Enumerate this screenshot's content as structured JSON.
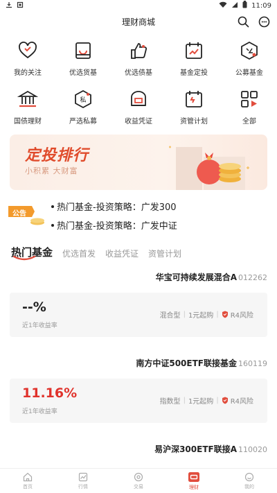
{
  "status": {
    "time": "11:09"
  },
  "header": {
    "title": "理财商城"
  },
  "grid": [
    {
      "label": "我的关注",
      "icon": "heart-icon"
    },
    {
      "label": "优选货基",
      "icon": "card-icon"
    },
    {
      "label": "优选债基",
      "icon": "thumbs-up-icon"
    },
    {
      "label": "基金定投",
      "icon": "calendar-chart-icon"
    },
    {
      "label": "公募基金",
      "icon": "public-fund-icon"
    },
    {
      "label": "国债理财",
      "icon": "bank-icon"
    },
    {
      "label": "严选私募",
      "icon": "private-fund-icon"
    },
    {
      "label": "收益凭证",
      "icon": "certificate-icon"
    },
    {
      "label": "资管计划",
      "icon": "plan-calendar-icon"
    },
    {
      "label": "全部",
      "icon": "all-apps-icon"
    }
  ],
  "banner": {
    "title": "定投排行",
    "subtitle": "小积累 大财富"
  },
  "notice": {
    "badge": "公告",
    "lines": [
      "热门基金-投资策略：广发300",
      "热门基金-投资策略：广发中证"
    ]
  },
  "tabs": [
    "热门基金",
    "优选首发",
    "收益凭证",
    "资管计划"
  ],
  "funds": [
    {
      "name": "华宝可持续发展混合A",
      "code": "012262",
      "rate": "--%",
      "rate_label": "近1年收益率",
      "type": "混合型",
      "min": "1元起购",
      "risk": "R4风险",
      "rate_color": "#222222"
    },
    {
      "name": "南方中证500ETF联接基金",
      "code": "160119",
      "rate": "11.16%",
      "rate_label": "近1年收益率",
      "type": "指数型",
      "min": "1元起购",
      "risk": "R4风险",
      "rate_color": "#e0332c"
    },
    {
      "name": "易沪深300ETF联接A",
      "code": "110020"
    }
  ],
  "nav": [
    {
      "label": "首页",
      "icon": "home-icon"
    },
    {
      "label": "行情",
      "icon": "market-icon"
    },
    {
      "label": "交易",
      "icon": "trade-icon"
    },
    {
      "label": "理财",
      "icon": "wealth-icon"
    },
    {
      "label": "我的",
      "icon": "profile-icon"
    }
  ],
  "colors": {
    "accent": "#e14d3d",
    "banner_title": "#e04b2b"
  }
}
